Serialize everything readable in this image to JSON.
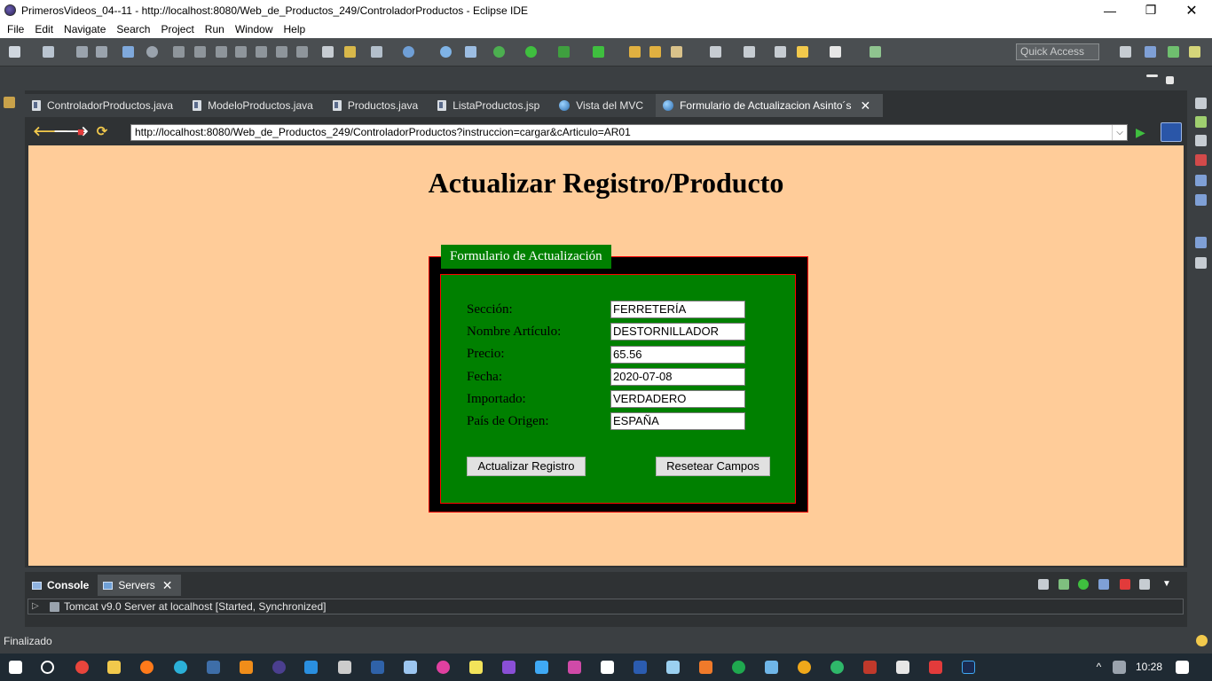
{
  "window": {
    "title": "PrimerosVideos_04--11 - http://localhost:8080/Web_de_Productos_249/ControladorProductos - Eclipse IDE",
    "min": "—",
    "max": "❐",
    "close": "✕"
  },
  "menu": [
    "File",
    "Edit",
    "Navigate",
    "Search",
    "Project",
    "Run",
    "Window",
    "Help"
  ],
  "toolbar": {
    "quick_access": "Quick Access"
  },
  "tabs": [
    {
      "label": "ControladorProductos.java",
      "icon": "java-file-icon"
    },
    {
      "label": "ModeloProductos.java",
      "icon": "java-file-icon"
    },
    {
      "label": "Productos.java",
      "icon": "java-file-icon"
    },
    {
      "label": "ListaProductos.jsp",
      "icon": "jsp-file-icon"
    },
    {
      "label": "Vista del MVC",
      "icon": "globe-icon"
    },
    {
      "label": "Formulario de Actualizacion Asinto´s",
      "icon": "globe-icon",
      "close": "✕"
    }
  ],
  "browser": {
    "url": "http://localhost:8080/Web_de_Productos_249/ControladorProductos?instruccion=cargar&cArticulo=AR01",
    "back": "🡐",
    "forward": "🡒",
    "stop": "■",
    "refresh": "⟳",
    "dropdown": "⌵",
    "go": "▶"
  },
  "page": {
    "title": "Actualizar Registro/Producto",
    "legend": "Formulario de Actualización",
    "fields": [
      {
        "label": "Sección:",
        "value": "FERRETERÍA"
      },
      {
        "label": "Nombre Artículo:",
        "value": "DESTORNILLADOR"
      },
      {
        "label": "Precio:",
        "value": "65.56"
      },
      {
        "label": "Fecha:",
        "value": "2020-07-08"
      },
      {
        "label": "Importado:",
        "value": "VERDADERO"
      },
      {
        "label": "País de Origen:",
        "value": "ESPAÑA"
      }
    ],
    "submit": "Actualizar Registro",
    "reset": "Resetear Campos"
  },
  "bottom": {
    "tabs": [
      {
        "label": "Console"
      },
      {
        "label": "Servers",
        "close": "✕"
      }
    ],
    "server_row": "Tomcat v9.0 Server at localhost  [Started, Synchronized]",
    "expand": "▷"
  },
  "status": "Finalizado",
  "clock": "10:28",
  "colors": {
    "page_bg": "#ffcc99",
    "form_green": "#008000",
    "form_border": "#ff0000"
  }
}
